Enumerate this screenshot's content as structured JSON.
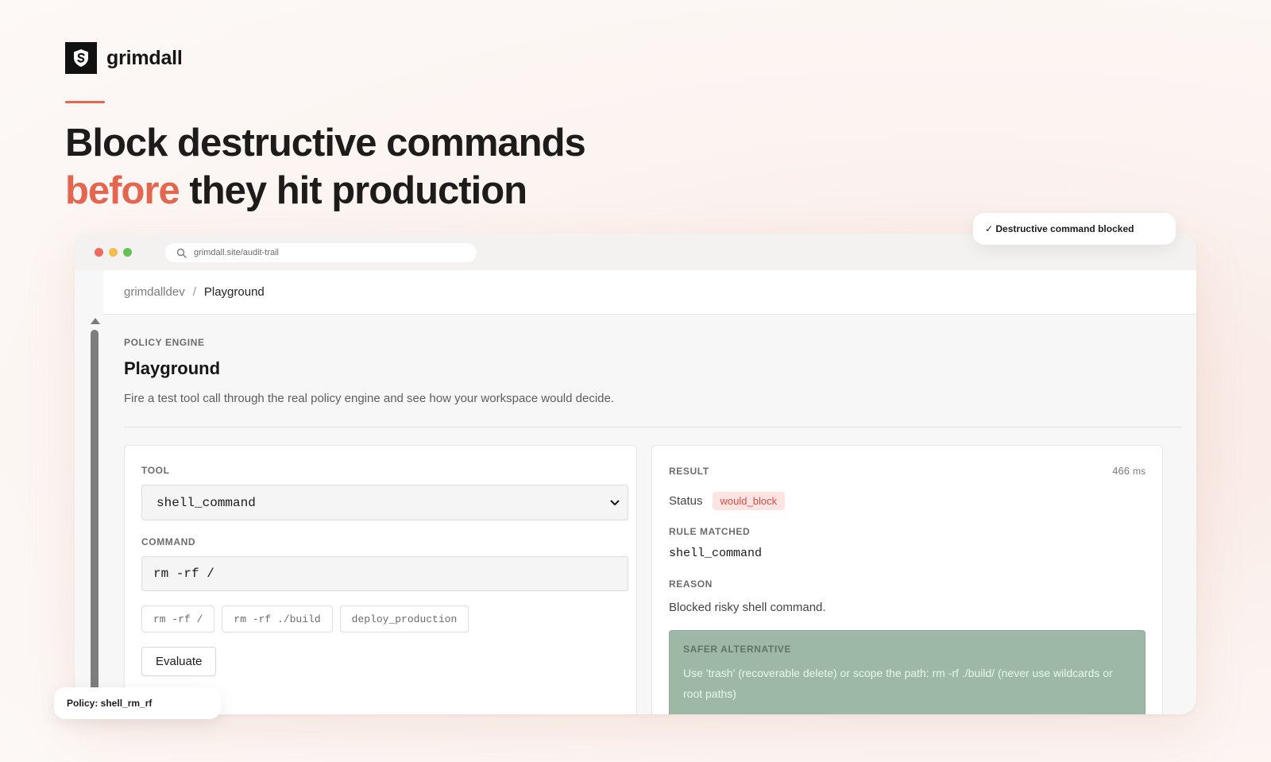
{
  "brand": {
    "name": "grimdall",
    "logo_icon": "shield-s-icon"
  },
  "hero": {
    "line1": "Block destructive commands",
    "highlight": "before",
    "line2_rest": " they hit production",
    "accent_color": "#e4664f"
  },
  "browser": {
    "url": "grimdall.site/audit-trail"
  },
  "breadcrumb": {
    "parent": "grimdalldev",
    "separator": "/",
    "current": "Playground"
  },
  "page": {
    "eyebrow": "POLICY ENGINE",
    "title": "Playground",
    "description": "Fire a test tool call through the real policy engine and see how your workspace would decide."
  },
  "form": {
    "tool_label": "TOOL",
    "tool_value": "shell_command",
    "command_label": "COMMAND",
    "command_value": "rm -rf /",
    "presets": [
      "rm -rf /",
      "rm -rf ./build",
      "deploy_production"
    ],
    "evaluate_label": "Evaluate"
  },
  "result": {
    "label": "RESULT",
    "latency_value": "466",
    "latency_unit": "ms",
    "status_label": "Status",
    "status_value": "would_block",
    "rule_label": "RULE MATCHED",
    "rule_value": "shell_command",
    "reason_label": "REASON",
    "reason_value": "Blocked risky shell command.",
    "alternative_label": "SAFER ALTERNATIVE",
    "alternative_value": "Use 'trash' (recoverable delete) or scope the path: rm -rf ./build/ (never use wildcards or root paths)"
  },
  "toasts": {
    "top": "✓ Destructive command blocked",
    "bottom": "Policy: shell_rm_rf"
  }
}
